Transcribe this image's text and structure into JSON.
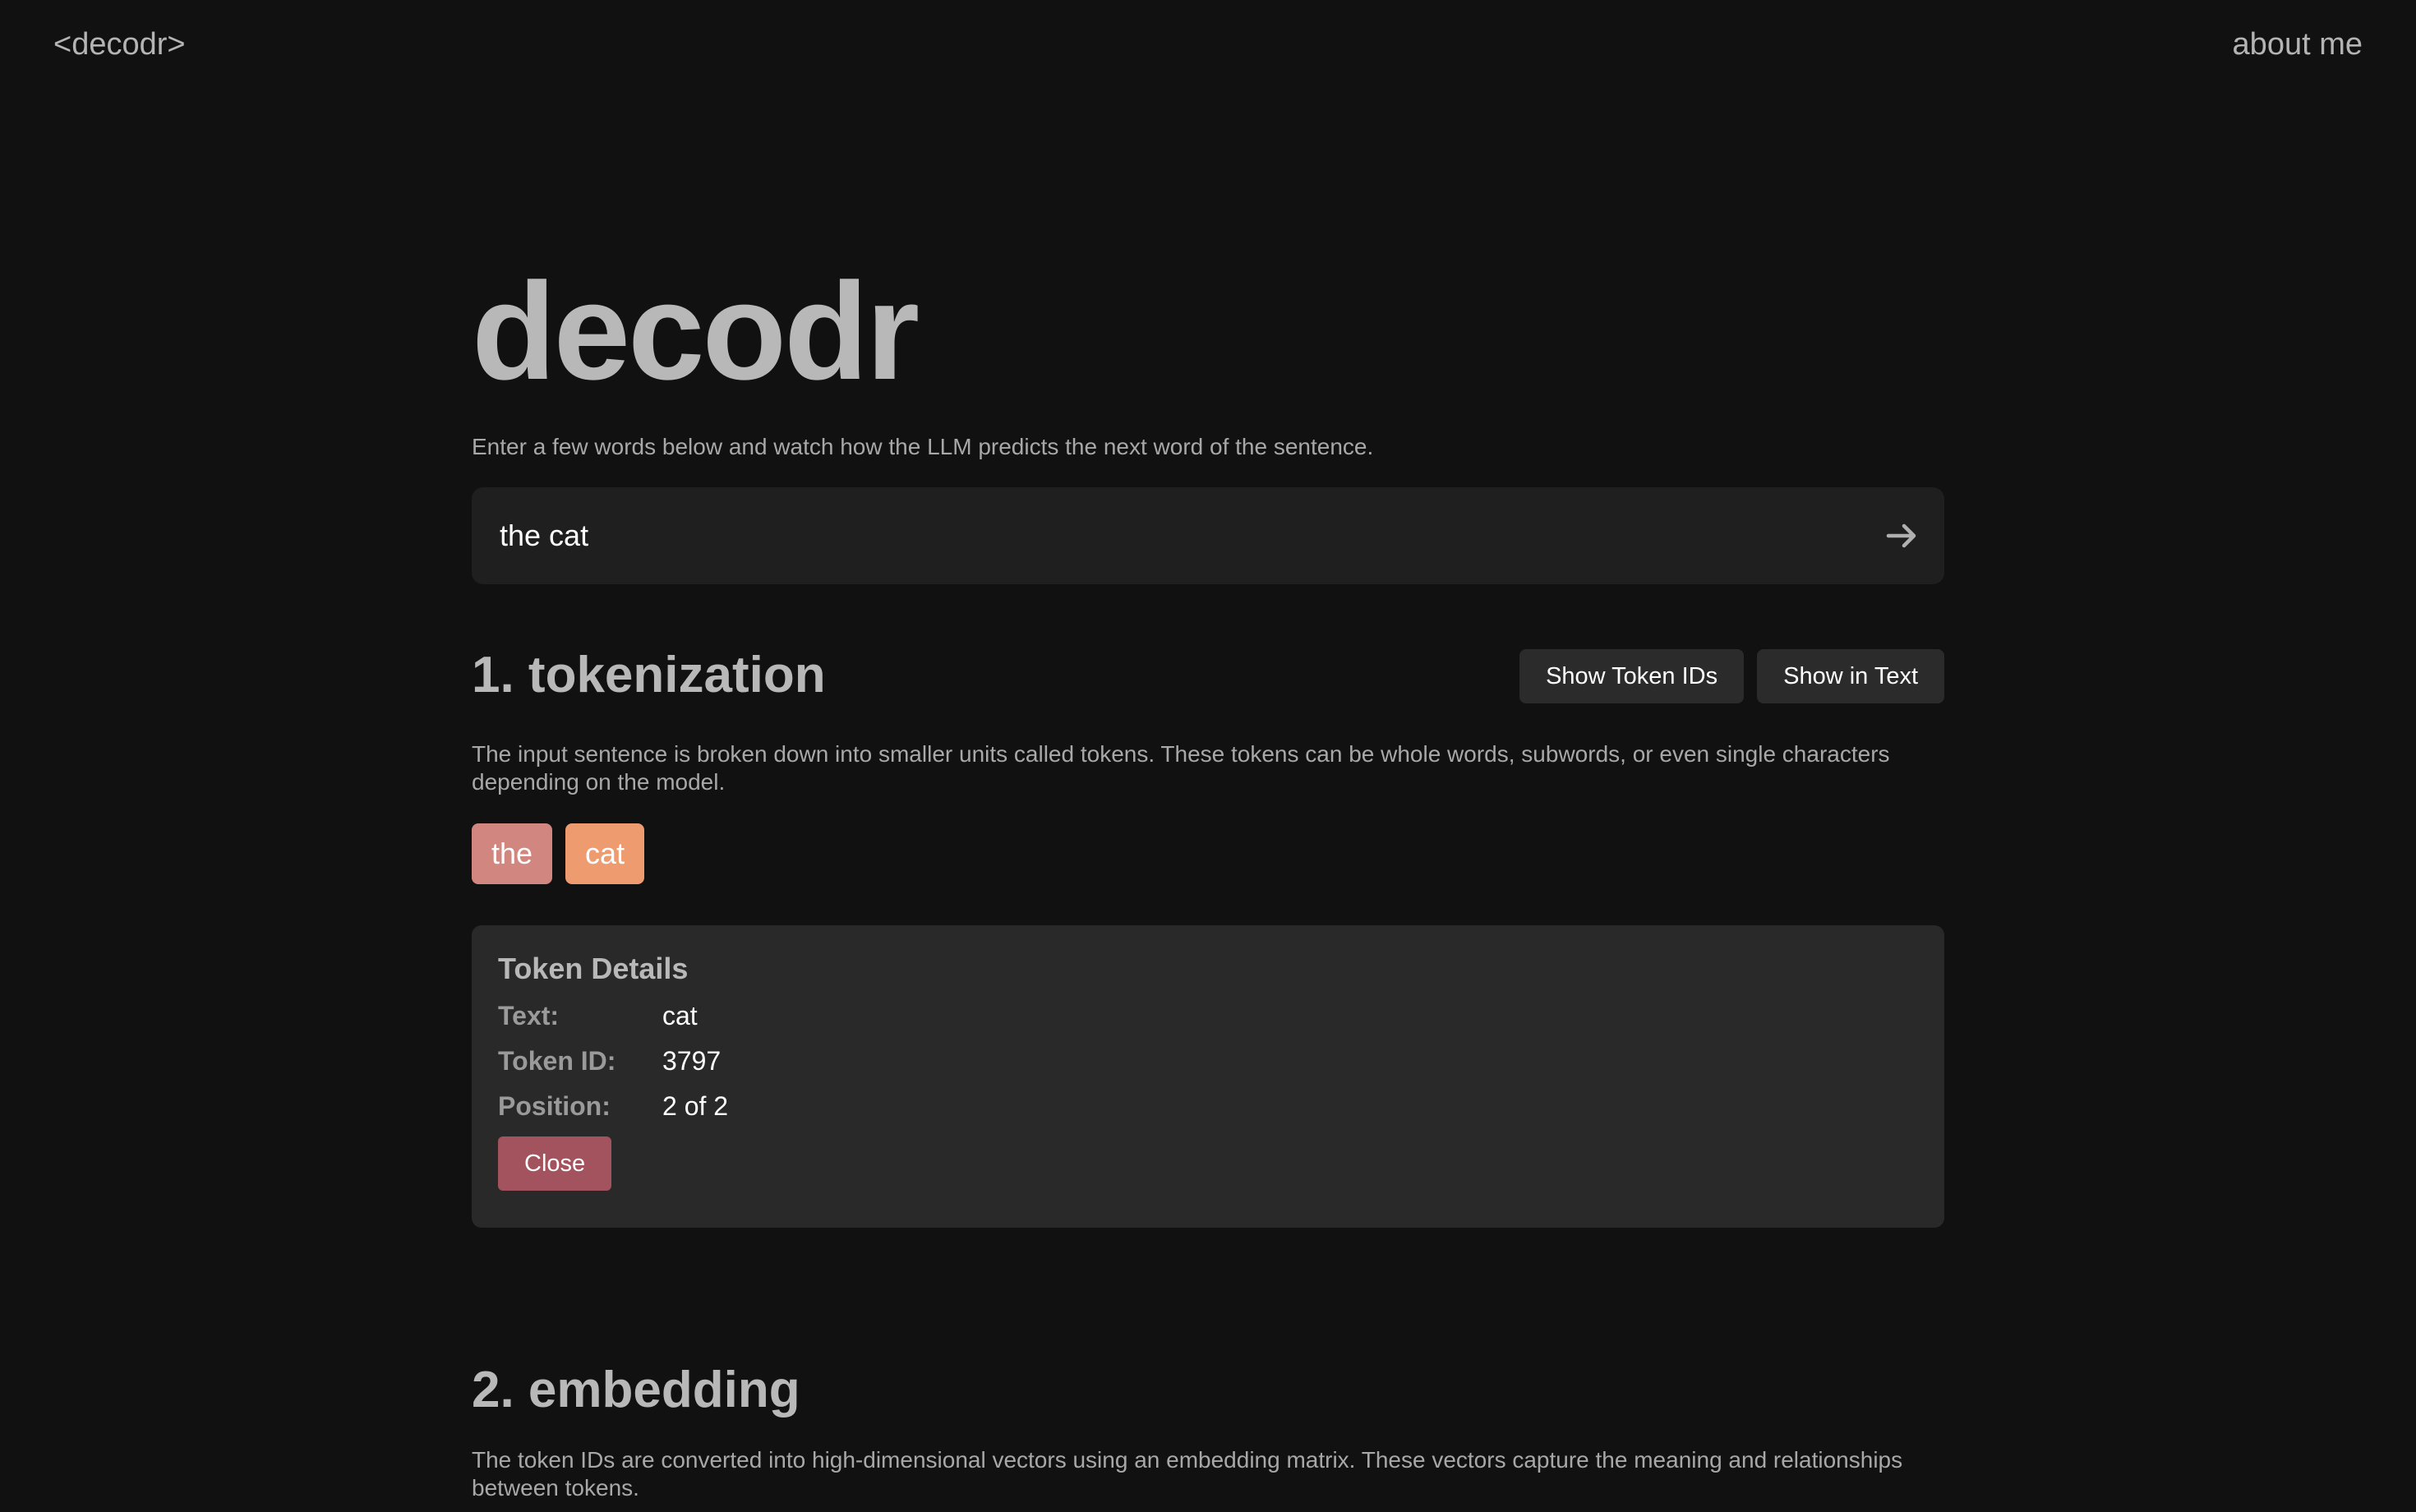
{
  "nav": {
    "logo": "<decodr>",
    "about": "about me"
  },
  "hero": {
    "title": "decodr",
    "subtitle": "Enter a few words below and watch how the LLM predicts the next word of the sentence."
  },
  "input": {
    "value": "the cat",
    "submit_icon": "arrow-right-icon"
  },
  "tokenization": {
    "title": "1. tokenization",
    "buttons": {
      "show_ids": "Show Token IDs",
      "show_in_text": "Show in Text"
    },
    "description": "The input sentence is broken down into smaller units called tokens. These tokens can be whole words, subwords, or even single characters depending on the model.",
    "tokens": [
      {
        "text": "the",
        "color": "#d1877f"
      },
      {
        "text": "cat",
        "color": "#ee9b70"
      }
    ],
    "details": {
      "title": "Token Details",
      "text_label": "Text:",
      "text_value": "cat",
      "id_label": "Token ID:",
      "id_value": "3797",
      "position_label": "Position:",
      "position_value": "2 of 2",
      "close_label": "Close",
      "close_color": "#a3535e"
    }
  },
  "embedding": {
    "title": "2. embedding",
    "description": "The token IDs are converted into high-dimensional vectors using an embedding matrix. These vectors capture the meaning and relationships between tokens."
  }
}
